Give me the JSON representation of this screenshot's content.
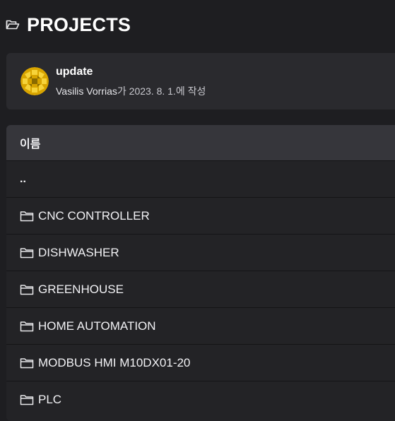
{
  "page": {
    "title": "PROJECTS",
    "icon": "folder-open-icon"
  },
  "commit": {
    "message": "update",
    "author": "Vasilis Vorrias",
    "meta_suffix": "가 2023. 8. 1.에 작성",
    "avatar_icon": "identicon-avatar",
    "colors": {
      "avatar_primary": "#d8a400",
      "avatar_secondary": "#f2c81e"
    }
  },
  "table": {
    "column_name": "이름",
    "parent_label": "..",
    "rows": [
      {
        "name": "CNC CONTROLLER",
        "icon": "folder-icon"
      },
      {
        "name": "DISHWASHER",
        "icon": "folder-icon"
      },
      {
        "name": "GREENHOUSE",
        "icon": "folder-icon"
      },
      {
        "name": "HOME AUTOMATION",
        "icon": "folder-icon"
      },
      {
        "name": "MODBUS HMI M10DX01-20",
        "icon": "folder-icon"
      },
      {
        "name": "PLC",
        "icon": "folder-icon"
      }
    ]
  },
  "colors": {
    "background": "#1e1e21",
    "card": "#2a2a2e",
    "table_header": "#36363b",
    "row": "#232326",
    "text": "#ffffff"
  }
}
